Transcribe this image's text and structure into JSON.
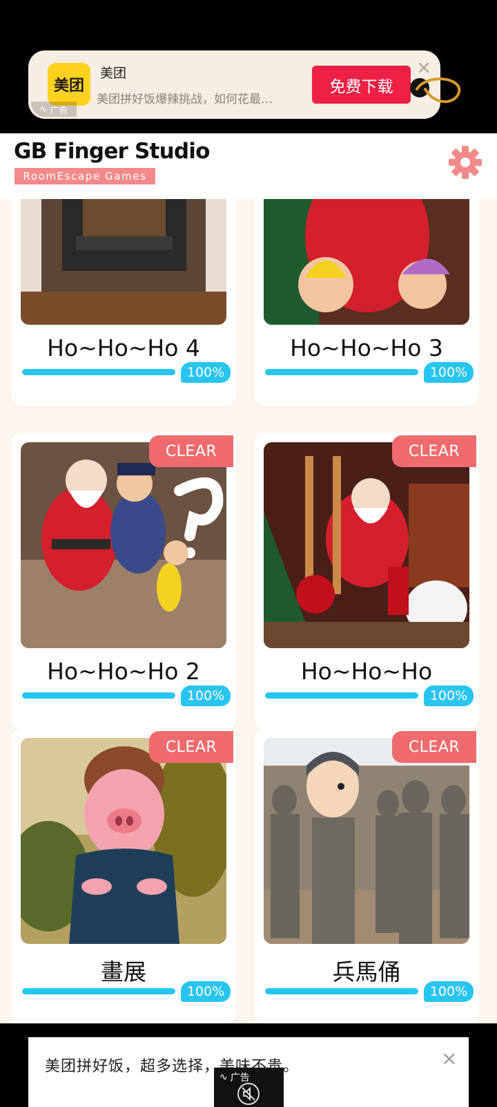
{
  "ad_top": {
    "app_name": "美团",
    "logo_text": "美团",
    "description": "美团拼好饭爆辣挑战，如何花最…",
    "download_label": "免费下载",
    "close_glyph": "×",
    "ad_tag": "广告"
  },
  "header": {
    "title": "GB Finger Studio",
    "subtitle": "RoomEscape Games",
    "settings_icon": "gear-icon",
    "accent_color": "#f38a8a"
  },
  "games": [
    {
      "title": "Ho~Ho~Ho 4",
      "progress_label": "100%",
      "progress": 1.0,
      "clear_label": ""
    },
    {
      "title": "Ho~Ho~Ho 3",
      "progress_label": "100%",
      "progress": 1.0,
      "clear_label": ""
    },
    {
      "title": "Ho~Ho~Ho 2",
      "progress_label": "100%",
      "progress": 1.0,
      "clear_label": "CLEAR"
    },
    {
      "title": "Ho~Ho~Ho",
      "progress_label": "100%",
      "progress": 1.0,
      "clear_label": "CLEAR"
    },
    {
      "title": "畫展",
      "progress_label": "100%",
      "progress": 1.0,
      "clear_label": "CLEAR"
    },
    {
      "title": "兵馬俑",
      "progress_label": "100%",
      "progress": 1.0,
      "clear_label": "CLEAR"
    }
  ],
  "ad_bottom": {
    "text": "美团拼好饭，超多选择，美味不贵。",
    "ad_tag": "广告",
    "close_glyph": "×"
  },
  "colors": {
    "progress": "#27c5ef",
    "clear_badge": "#f06b6d",
    "background": "#fdf6ee"
  }
}
